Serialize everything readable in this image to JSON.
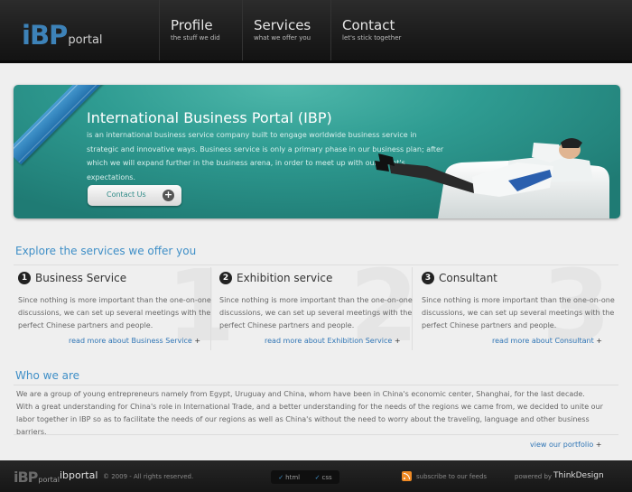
{
  "header": {
    "logo_mark": "iBP",
    "logo_sub": "portal",
    "nav": [
      {
        "title": "Profile",
        "sub": "the stuff we did"
      },
      {
        "title": "Services",
        "sub": "what we offer you"
      },
      {
        "title": "Contact",
        "sub": "let's stick together"
      }
    ]
  },
  "hero": {
    "title": "International Business Portal (IBP)",
    "description": "is an international business service company built to engage worldwide business service in strategic and innovative ways. Business service is only a primary phase in our business plan; after which we will expand further in the business arena, in order to meet up with our client's expectations.",
    "button_label": "Contact Us",
    "button_icon": "plus-circle-icon"
  },
  "services": {
    "heading": "Explore the services we offer you",
    "items": [
      {
        "number": "1",
        "title": "Business Service",
        "text": "Since nothing is more important than the one-on-one discussions, we can set up several meetings with the perfect Chinese partners and people.",
        "link": "read more about Business Service",
        "plus": "+"
      },
      {
        "number": "2",
        "title": "Exhibition service",
        "text": "Since nothing is more important than the one-on-one discussions, we can set up several meetings with the perfect Chinese partners and people.",
        "link": "read more about Exhibition Service",
        "plus": "+"
      },
      {
        "number": "3",
        "title": "Consultant",
        "text": "Since nothing is more important than the one-on-one discussions, we can set up several meetings with the perfect Chinese partners and people.",
        "link": "read more about Consultant",
        "plus": "+"
      }
    ]
  },
  "who": {
    "heading": "Who we are",
    "paragraph1": "We are a group of young entrepreneurs namely from Egypt, Uruguay and China, whom have been in China's economic center, Shanghai, for the last decade.",
    "paragraph2": "With a great understanding for China's role in International Trade, and a better understanding for the needs of the regions we came from, we decided to unite our labor together in IBP so as to facilitate the needs of our regions as well as China's without the need to worry about the traveling, language and other business barriers.",
    "portfolio_link": "view our portfolio",
    "plus": "+"
  },
  "footer": {
    "logo_mark": "iBP",
    "logo_sub": "portal",
    "name": "ibportal",
    "copyright": "© 2009 - All rights reserved.",
    "badges": [
      "html",
      "css"
    ],
    "badge_tick": "✓",
    "subscribe": "subscribe to our feeds",
    "powered_by": "powered by",
    "brand": "ThinkDesign"
  },
  "colors": {
    "accent_blue": "#3f8fc7",
    "hero_teal": "#2f9c92",
    "link_blue": "#2f75b5",
    "rss_orange": "#f08a24"
  }
}
